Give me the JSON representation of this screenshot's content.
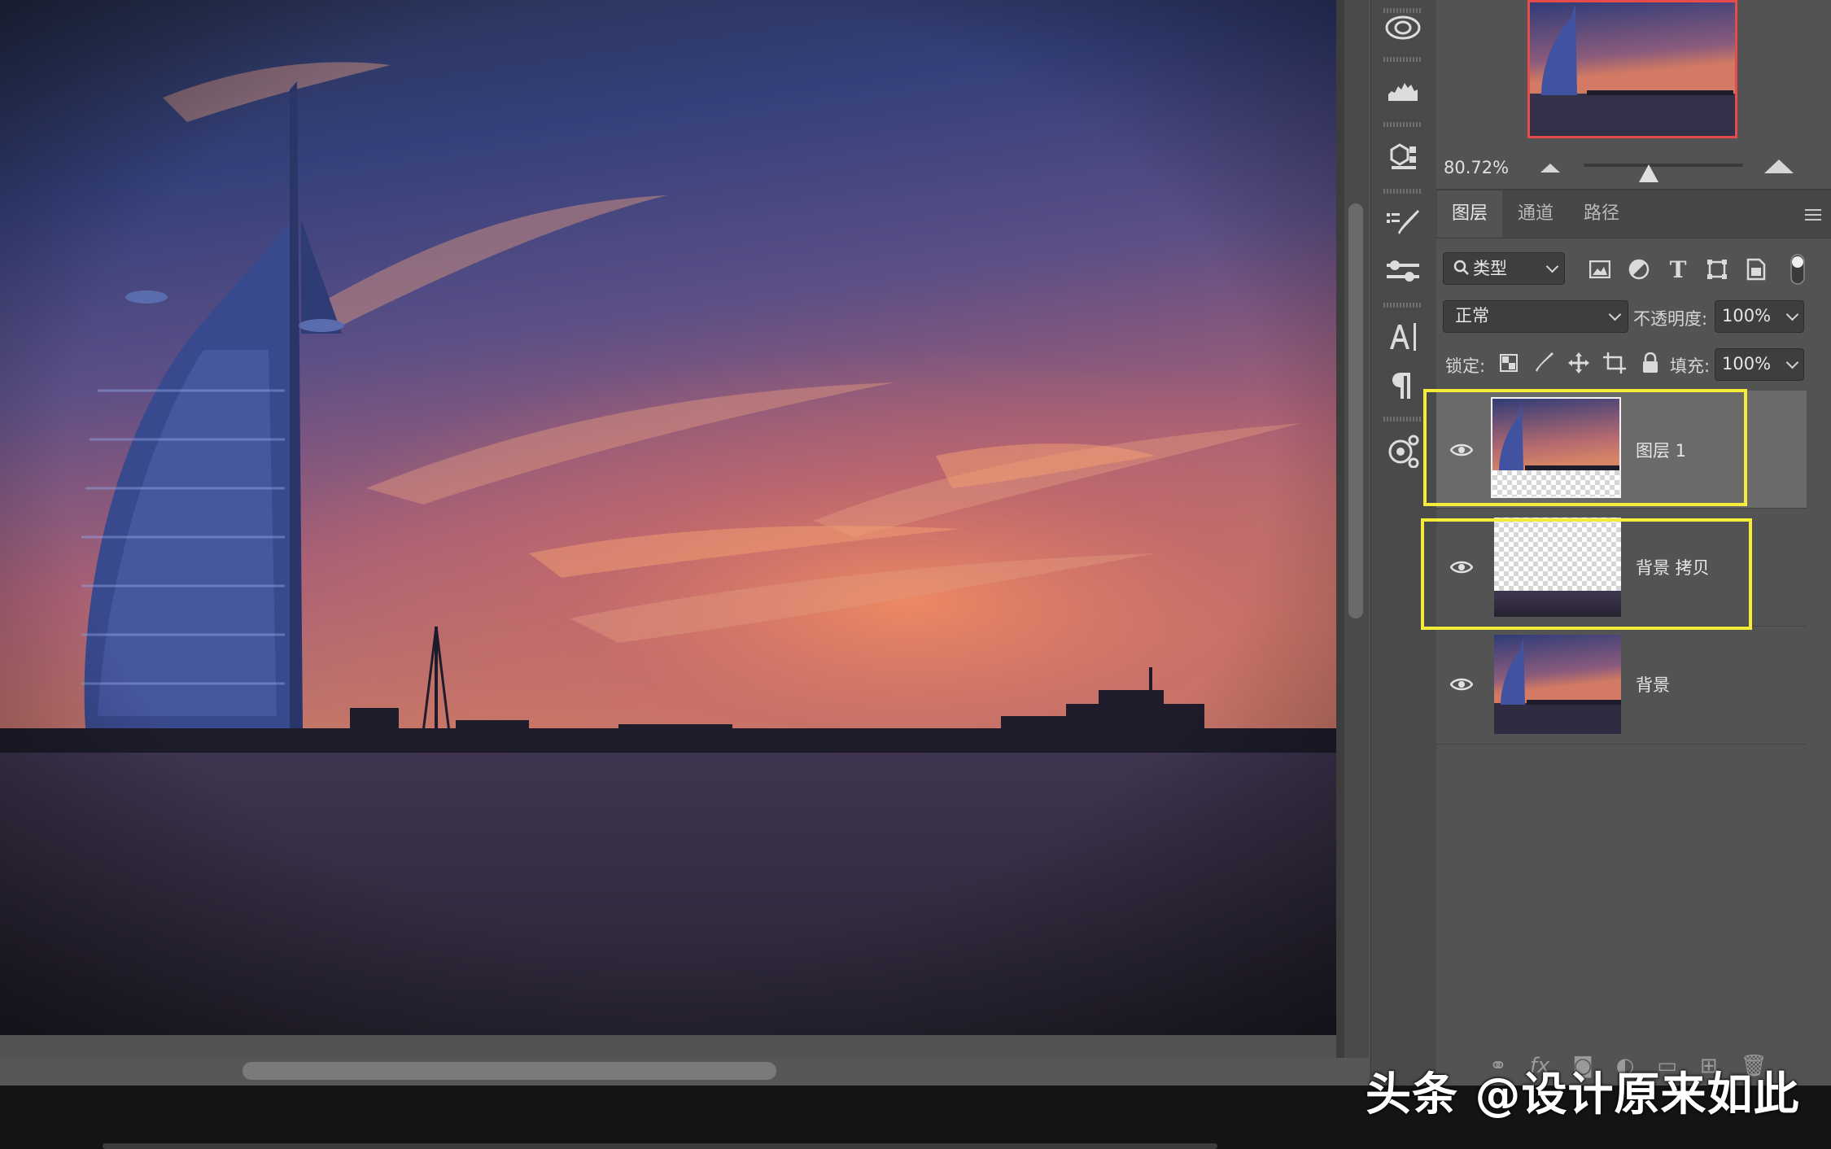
{
  "navigator": {
    "zoom": "80.72%",
    "zoom_slider_fraction": 0.41
  },
  "tabs": [
    {
      "label": "图层",
      "active": true
    },
    {
      "label": "通道",
      "active": false
    },
    {
      "label": "路径",
      "active": false
    }
  ],
  "filter": {
    "kind_label": "类型",
    "icons": [
      "image-filter-icon",
      "adjustment-filter-icon",
      "type-filter-icon",
      "shape-filter-icon",
      "smart-object-filter-icon",
      "filter-toggle-icon"
    ]
  },
  "blend": {
    "mode": "正常",
    "opacity_label": "不透明度:",
    "opacity_value": "100%"
  },
  "lock": {
    "label": "锁定:",
    "icons": [
      "lock-transparent-icon",
      "lock-image-icon",
      "lock-position-icon",
      "lock-artboard-icon",
      "lock-all-icon"
    ],
    "fill_label": "填充:",
    "fill_value": "100%"
  },
  "layers": [
    {
      "name": "图层 1",
      "visible": true,
      "selected": true,
      "highlighted": true
    },
    {
      "name": "背景 拷贝",
      "visible": true,
      "selected": false,
      "highlighted": true
    },
    {
      "name": "背景",
      "visible": true,
      "selected": false,
      "highlighted": false
    }
  ],
  "tool_strip_icons": [
    "libraries-icon",
    "histogram-icon",
    "3d-icon",
    "brush-presets-icon",
    "properties-icon",
    "character-icon",
    "paragraph-icon",
    "glyphs-icon"
  ],
  "footer_icons": [
    "link-layers-icon",
    "fx-icon",
    "add-mask-icon",
    "adjustment-layer-icon",
    "new-group-icon",
    "new-layer-icon",
    "delete-layer-icon"
  ],
  "watermark": "头条 @设计原来如此",
  "colors": {
    "highlight": "#f5ec3a",
    "navigator_border": "#e64a4a",
    "panel_bg": "#535353"
  }
}
